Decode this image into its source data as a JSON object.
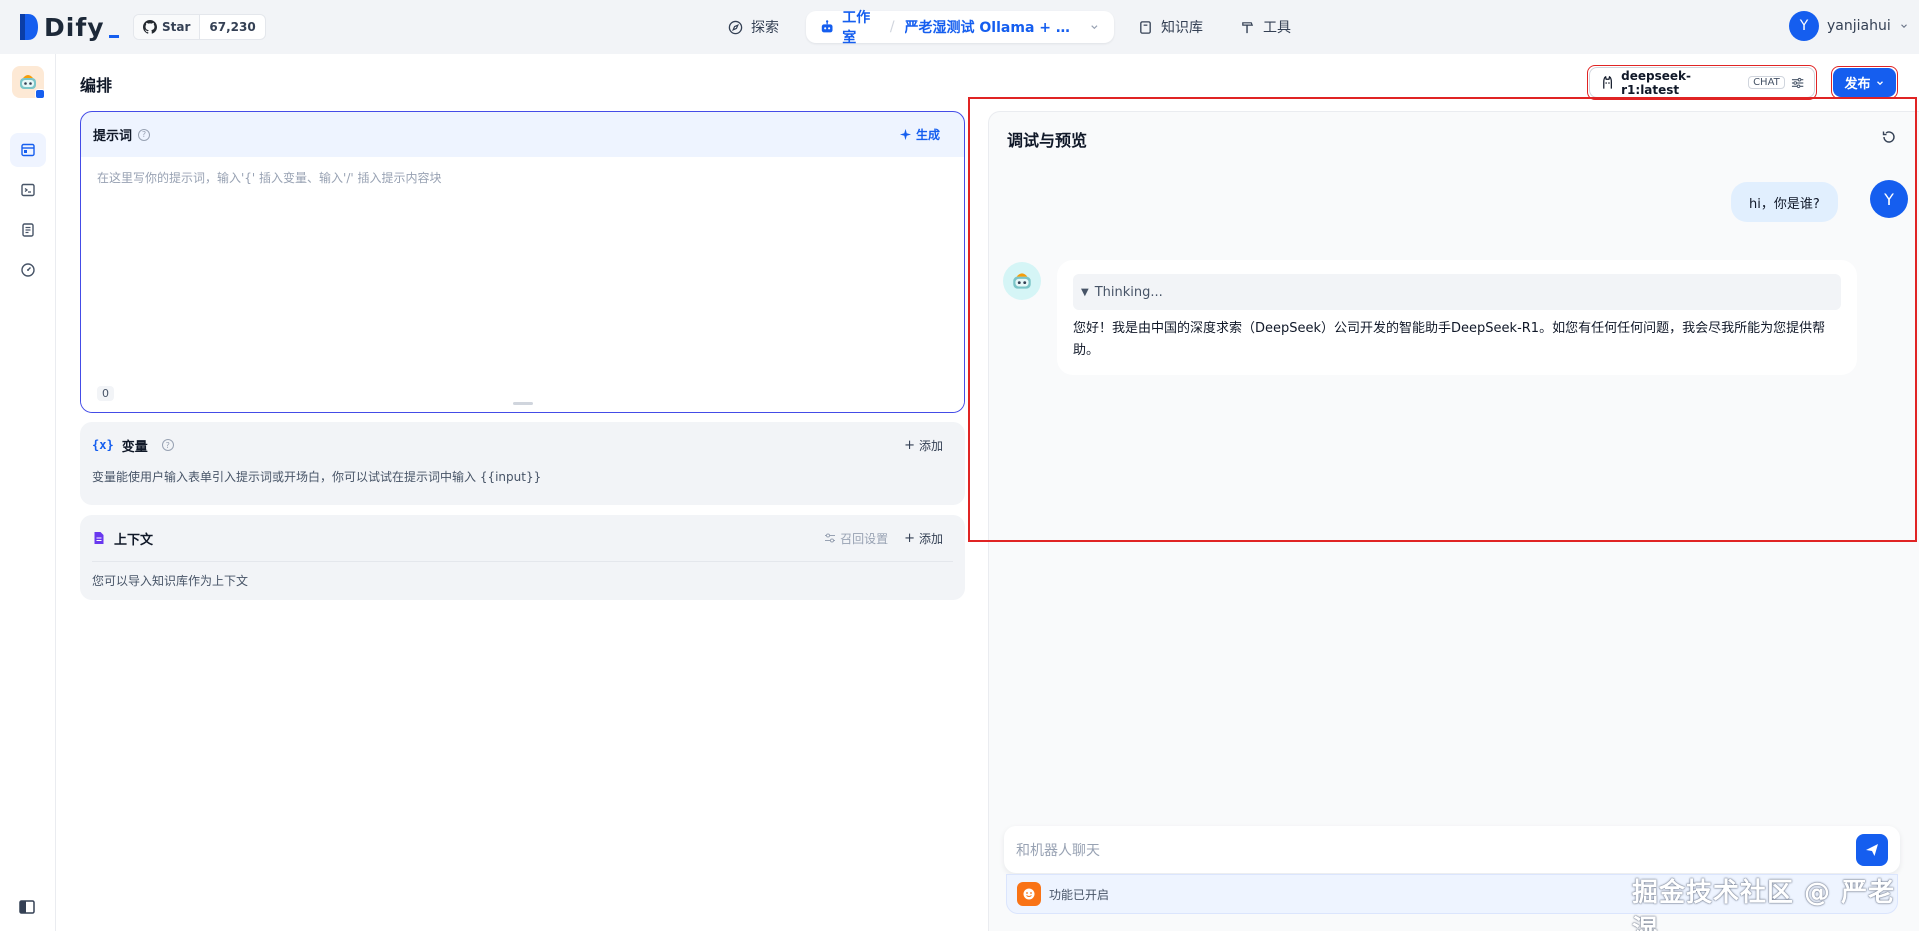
{
  "brand": {
    "name": "Dify"
  },
  "github": {
    "star_label": "Star",
    "count": "67,230"
  },
  "nav": {
    "explore": "探索",
    "studio": "工作室",
    "app_name": "严老湿测试 Ollama + Dee...",
    "knowledge": "知识库",
    "tools": "工具"
  },
  "user": {
    "initial": "Y",
    "name": "yanjiahui"
  },
  "page": {
    "heading": "编排"
  },
  "prompt": {
    "title": "提示词",
    "generate_label": "生成",
    "placeholder": "在这里写你的提示词，输入'{' 插入变量、输入'/' 插入提示内容块",
    "char_count": "0"
  },
  "variables": {
    "title": "变量",
    "add_label": "添加",
    "description": "变量能使用户输入表单引入提示词或开场白，你可以试试在提示词中输入 {{input}}"
  },
  "context": {
    "title": "上下文",
    "retrieval_label": "召回设置",
    "add_label": "添加",
    "description": "您可以导入知识库作为上下文"
  },
  "model": {
    "name": "deepseek-r1:latest",
    "mode_tag": "CHAT"
  },
  "publish": {
    "label": "发布"
  },
  "debug": {
    "title": "调试与预览",
    "user_initial": "Y",
    "user_message": "hi，你是谁?",
    "thinking_label": "Thinking...",
    "bot_message": "您好！我是由中国的深度求索（DeepSeek）公司开发的智能助手DeepSeek-R1。如您有任何任何问题，我会尽我所能为您提供帮助。",
    "input_placeholder": "和机器人聊天",
    "feature_status": "功能已开启"
  },
  "watermark": "掘金技术社区 @ 严老湿",
  "colors": {
    "accent": "#155eef",
    "highlight": "#e02424",
    "prompt_border": "#444ce7"
  }
}
